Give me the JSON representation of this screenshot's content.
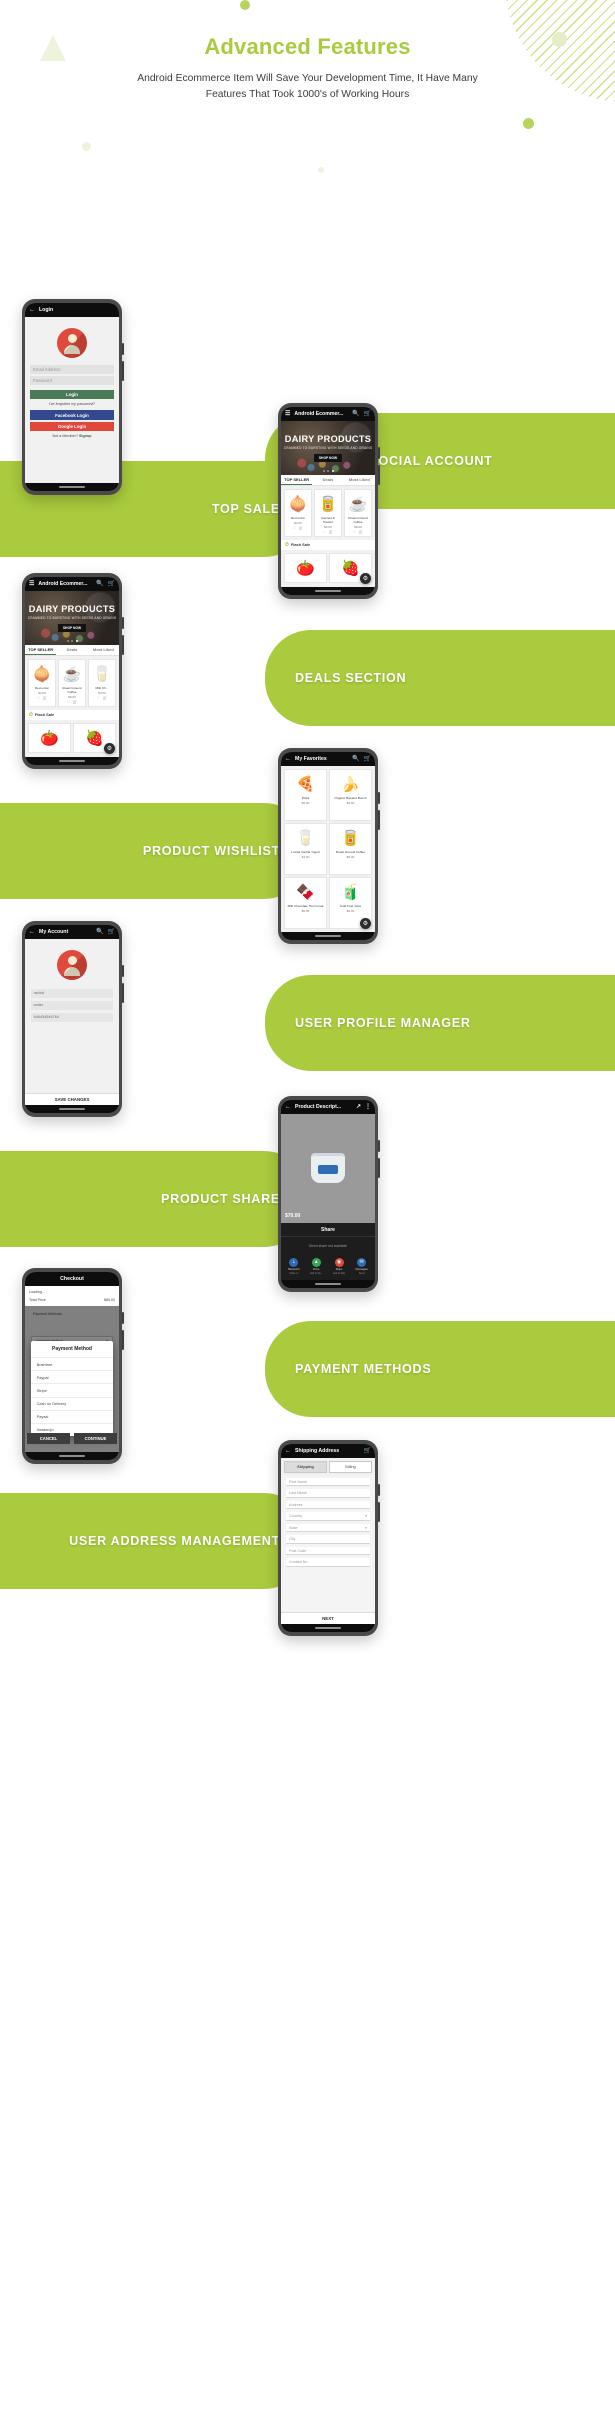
{
  "header": {
    "title": "Advanced Features",
    "subtitle": "Android Ecommerce Item Will Save Your Development Time, It Have Many Features That Took 1000's of Working Hours",
    "accent_color": "#a9cb3d"
  },
  "features": [
    {
      "label": "LOGIN VIA SOCIAL ACCOUNT"
    },
    {
      "label": "TOP SALE"
    },
    {
      "label": "DEALS SECTION"
    },
    {
      "label": "PRODUCT WISHLIST"
    },
    {
      "label": "USER PROFILE MANAGER"
    },
    {
      "label": "PRODUCT SHARE"
    },
    {
      "label": "PAYMENT METHODS"
    },
    {
      "label": "USER ADDRESS MANAGEMENT"
    }
  ],
  "login_screen": {
    "nav_title": "Login",
    "back_icon": "arrow-left-icon",
    "email_placeholder": "Email Address",
    "password_placeholder": "Password",
    "login_button": "Login",
    "forgot_link": "I've forgotten my password?",
    "facebook_button": "Facebook Login",
    "google_button": "Google Login",
    "signup_prefix": "Not a Member?",
    "signup_link": "Signup"
  },
  "catalog_screen": {
    "nav_title": "Android Ecommer...",
    "menu_icon": "hamburger-icon",
    "search_icon": "search-icon",
    "cart_icon": "cart-icon",
    "hero_title": "DAIRY PRODUCTS",
    "hero_subtitle": "CRAMMED TO BURSTING WITH SEEDS AND GRAINS",
    "hero_cta": "SHOP NOW",
    "tabs": [
      {
        "label": "TOP SELLER",
        "active": true
      },
      {
        "label": "Deals",
        "active": false
      },
      {
        "label": "Most Liked",
        "active": false
      }
    ],
    "products": [
      {
        "name": "Red onion",
        "price": "$4.00",
        "glyph": "🧅"
      },
      {
        "name": "Canned & Packet",
        "price": "$6.00",
        "glyph": "🥫"
      },
      {
        "name": "Roast Ground Coffee",
        "price": "$8.00",
        "glyph": "☕"
      },
      {
        "name": "Milk Ch...",
        "price": "$3.00",
        "glyph": "🥛"
      }
    ],
    "flash_sale_label": "Flash Sale",
    "flash_sale_icon": "clock-icon",
    "flash_products": [
      {
        "name": "Tomato",
        "glyph": "🍅"
      },
      {
        "name": "Berry",
        "glyph": "🍓"
      }
    ],
    "fab_icon": "settings-icon"
  },
  "wishlist_screen": {
    "nav_title": "My Favorites",
    "back_icon": "arrow-left-icon",
    "search_icon": "search-icon",
    "cart_icon": "cart-icon",
    "items": [
      {
        "name": "Pizza",
        "price": "$9.00",
        "glyph": "🍕"
      },
      {
        "name": "Organic Banana Bunch",
        "price": "$4.00",
        "glyph": "🍌"
      },
      {
        "name": "Lowfat Vanilla Yogurt",
        "price": "$3.00",
        "glyph": "🥛"
      },
      {
        "name": "Roast Ground Coffee",
        "price": "$8.00",
        "glyph": "🥫"
      },
      {
        "name": "Milk Chocolate Hot Cocoa",
        "price": "$5.00",
        "glyph": "🍫"
      },
      {
        "name": "Cold Fruit Juice",
        "price": "$6.00",
        "glyph": "🧃"
      }
    ],
    "fab_icon": "settings-icon"
  },
  "account_screen": {
    "nav_title": "My Account",
    "back_icon": "arrow-left-icon",
    "search_icon": "search-icon",
    "cart_icon": "cart-icon",
    "avatar_icon": "user-avatar-icon",
    "fields": [
      {
        "value": "rachid"
      },
      {
        "value": "coder"
      },
      {
        "value": "646454546764"
      }
    ],
    "save_button": "SAVE CHANGES"
  },
  "share_screen": {
    "nav_title": "Product Descript...",
    "back_icon": "arrow-left-icon",
    "share_icon": "share-icon",
    "more_icon": "more-vertical-icon",
    "price": "$70.00",
    "sheet_title": "Share",
    "sheet_empty": "Direct share not available",
    "apps": [
      {
        "name": "Bluetooth",
        "sub": "Share to",
        "icon": "bluetooth-icon",
        "color": "#2f6cb5",
        "glyph": "ᛦ"
      },
      {
        "name": "Drive",
        "sub": "Add to My...",
        "icon": "drive-icon",
        "color": "#3aa757",
        "glyph": "▲"
      },
      {
        "name": "Maps",
        "sub": "Add to Map",
        "icon": "maps-icon",
        "color": "#e0483a",
        "glyph": "◉"
      },
      {
        "name": "Messages",
        "sub": "Send",
        "icon": "messages-icon",
        "color": "#2f6cb5",
        "glyph": "✉"
      }
    ]
  },
  "checkout_screen": {
    "nav_title": "Checkout",
    "summary_label": "Loading...",
    "summary_sub": "Total Price",
    "summary_value": "$80.00",
    "dialog_title": "Payment Method",
    "payment_options": [
      "Braintree",
      "Paypal",
      "Stripe",
      "Cash on Delivery",
      "Paysal",
      "Instamojo"
    ],
    "footer_field_label": "Payment Methods",
    "footer_select_label": "payment method",
    "cancel_button": "CANCEL",
    "continue_button": "CONTINUE"
  },
  "address_screen": {
    "nav_title": "Shipping Address",
    "back_icon": "arrow-left-icon",
    "cart_icon": "cart-icon",
    "tabs": [
      {
        "label": "Shipping",
        "active": true
      },
      {
        "label": "Billing",
        "active": false
      }
    ],
    "fields": [
      {
        "label": "First Name",
        "type": "text"
      },
      {
        "label": "Last Name",
        "type": "text"
      },
      {
        "label": "Address",
        "type": "text"
      },
      {
        "label": "Country",
        "type": "select"
      },
      {
        "label": "State",
        "type": "select"
      },
      {
        "label": "City",
        "type": "text"
      },
      {
        "label": "Post Code",
        "type": "text"
      },
      {
        "label": "Contact No",
        "type": "text"
      }
    ],
    "next_button": "NEXT"
  }
}
